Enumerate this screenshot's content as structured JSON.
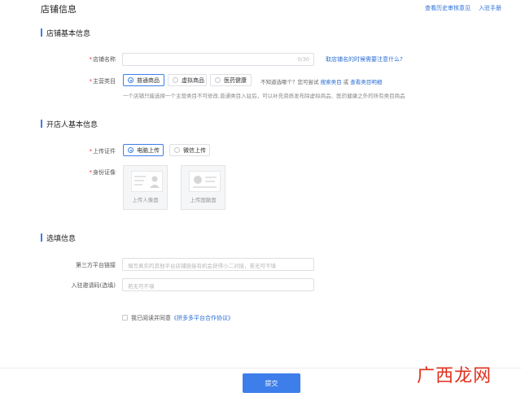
{
  "header": {
    "title": "店铺信息",
    "links": [
      "查看历史审核意见",
      "入驻手册"
    ]
  },
  "sections": {
    "basic": {
      "title": "店铺基本信息"
    },
    "owner": {
      "title": "开店人基本信息"
    },
    "optional": {
      "title": "选填信息"
    }
  },
  "store_name": {
    "label": "店铺名称",
    "counter": "0/30",
    "help_link": "取店铺名的时候需要注意什么?"
  },
  "category": {
    "label": "主营类目",
    "options": [
      "普通商品",
      "虚拟商品",
      "医药健康"
    ],
    "selected": "普通商品",
    "prompt": "不知道选哪个？您可尝试",
    "search_link": "搜索类目",
    "or": "或",
    "detail_link": "查看类目明细",
    "hint": "一个店铺只能选择一个主营类目不可修改,普通类目入驻后，可以补充资质发布除虚拟商品、医药健康之外的所有类目商品"
  },
  "upload_type": {
    "label": "上传证件",
    "options": [
      "电脑上传",
      "微信上传"
    ],
    "selected": "电脑上传"
  },
  "id_photo": {
    "label": "身份证像",
    "front_caption": "上传人像面",
    "back_caption": "上传国徽面"
  },
  "third_party": {
    "label": "第三方平台链接",
    "placeholder": "填写真实的其他平台店铺链接有机会获得小二对接，若无可不填"
  },
  "invite": {
    "label": "入驻邀请码(选填)",
    "placeholder": "若无可不填"
  },
  "agreement": {
    "text": "我已阅读并同意",
    "link": "《拼多多平台合作协议》"
  },
  "submit_label": "提交",
  "watermark": "广西龙网",
  "colors": {
    "accent": "#3d7eea",
    "link": "#2b6fd6",
    "required": "#e33333",
    "watermark": "#e0301e"
  }
}
